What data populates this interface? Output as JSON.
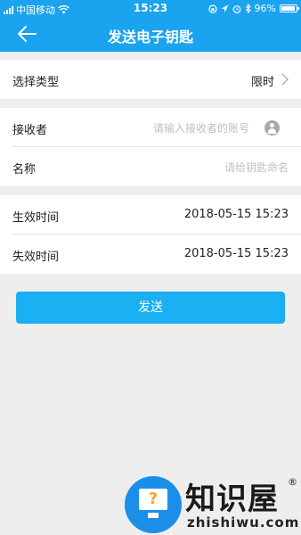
{
  "status_bar": {
    "carrier": "中国移动",
    "time": "15:23",
    "battery": "96%",
    "icons": [
      "signal-icon",
      "wifi-icon",
      "lock-rotation-icon",
      "location-icon",
      "alarm-icon",
      "bluetooth-icon",
      "battery-icon"
    ]
  },
  "nav": {
    "title": "发送电子钥匙",
    "back_icon": "arrow-left-icon"
  },
  "form": {
    "type_row": {
      "label": "选择类型",
      "value": "限时"
    },
    "receiver_row": {
      "label": "接收者",
      "placeholder": "请输入接收者的账号"
    },
    "name_row": {
      "label": "名称",
      "placeholder": "请给钥匙命名"
    },
    "start_row": {
      "label": "生效时间",
      "value": "2018-05-15 15:23"
    },
    "end_row": {
      "label": "失效时间",
      "value": "2018-05-15 15:23"
    }
  },
  "send_button": {
    "label": "发送"
  },
  "watermark": {
    "brand": "知识屋",
    "url": "zhishiwu.com",
    "mark": "®"
  },
  "colors": {
    "accent": "#1aa3ee",
    "button": "#1ab0f2",
    "background": "#eeeeee",
    "placeholder": "#c0c0c0"
  }
}
